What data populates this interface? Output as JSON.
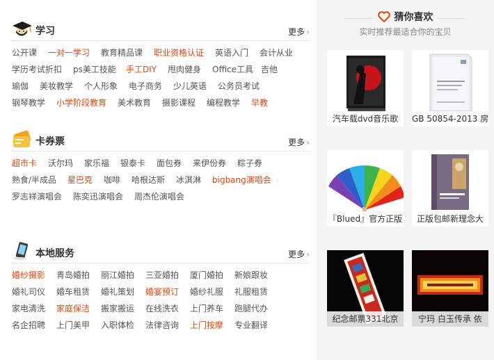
{
  "left": {
    "study": {
      "title": "学习",
      "more": "更多",
      "rows": [
        [
          "公开课",
          "一对一学习",
          "教育精品课",
          "职业资格认证",
          "英语入门",
          "会计从业"
        ],
        [
          "学历考试折扣",
          "ps美工技能",
          "手工DIY",
          "甩肉健身",
          "Office工具",
          "吉他"
        ],
        [
          "瑜伽",
          "美妆教学",
          "个人形象",
          "电子商务",
          "少儿英语",
          "公务员考试"
        ],
        [
          "钢琴教学",
          "小学阶段教育",
          "美术教育",
          "摄影课程",
          "编程教学",
          "早教"
        ]
      ]
    },
    "cards": {
      "title": "卡券票",
      "more": "更多",
      "rows": [
        [
          "超市卡",
          "沃尔玛",
          "家乐福",
          "银泰卡",
          "面包券",
          "来伊份券",
          "粽子券"
        ],
        [
          "熟食/半成品",
          "星巴克",
          "咖啡",
          "哈根达斯",
          "冰淇淋",
          "bigbang演唱会"
        ],
        [
          "罗志祥演唱会",
          "陈奕迅演唱会",
          "周杰伦演唱会"
        ]
      ]
    },
    "local": {
      "title": "本地服务",
      "more": "更多",
      "rows": [
        [
          "婚纱摄影",
          "青岛婚拍",
          "丽江婚拍",
          "三亚婚拍",
          "厦门婚拍",
          "新娘跟妆"
        ],
        [
          "婚礼司仪",
          "婚车租赁",
          "婚礼策划",
          "婚宴预订",
          "婚纱礼服",
          "礼服租赁"
        ],
        [
          "家电清洗",
          "家庭保洁",
          "搬家搬运",
          "在线洗衣",
          "上门养车",
          "跑腿代办"
        ],
        [
          "名企招聘",
          "上门美甲",
          "入职体检",
          "法律咨询",
          "上门按摩",
          "专业翻译"
        ]
      ]
    }
  },
  "right": {
    "title": "猜你喜欢",
    "subtitle": "实时推荐最适合你的宝贝",
    "items": [
      {
        "caption": "汽车载dvd音乐歌",
        "art": "cd"
      },
      {
        "caption": "GB 50854-2013 房",
        "art": "book"
      },
      {
        "caption": "『Blued』官方正版",
        "art": "fan"
      },
      {
        "caption": "正版包邮新理念大",
        "art": "textbook"
      },
      {
        "caption": "纪念邮票331北京",
        "art": "stamp"
      },
      {
        "caption": "宁玛 白玉传承 依",
        "art": "scroll"
      }
    ]
  },
  "colors": {
    "highlight": "#e4450f",
    "accent": "#e4450f"
  }
}
